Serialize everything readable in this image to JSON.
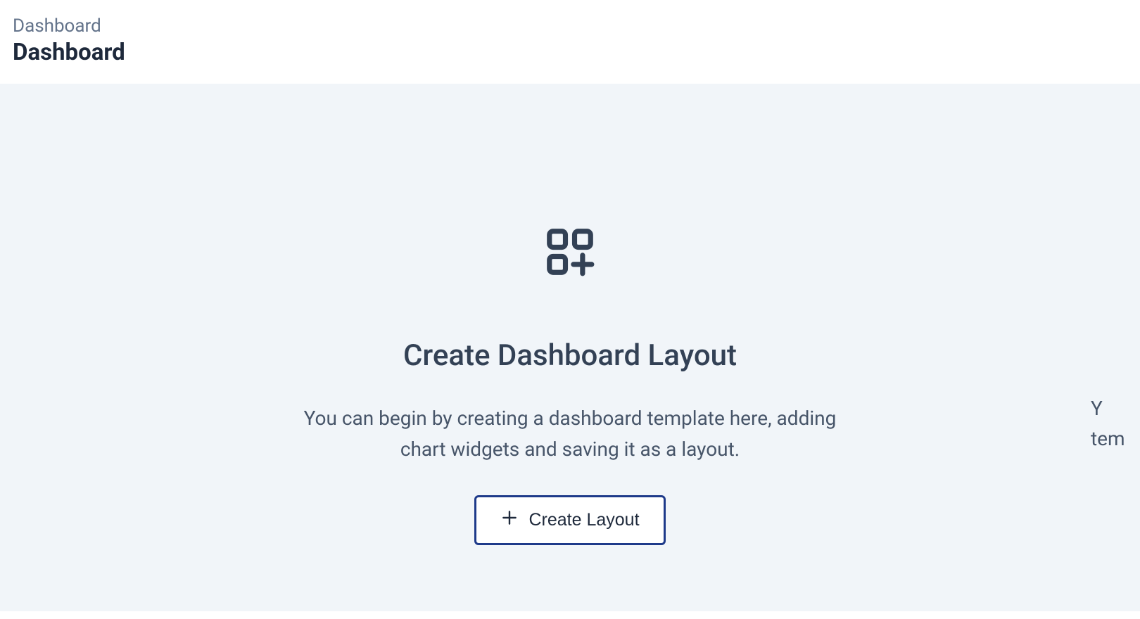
{
  "header": {
    "breadcrumb": "Dashboard",
    "title": "Dashboard"
  },
  "empty_state": {
    "heading": "Create Dashboard Layout",
    "description": "You can begin by creating a dashboard template here, adding chart widgets and saving it as a layout.",
    "button_label": "Create Layout"
  },
  "peek": {
    "partial": "Y\ntem"
  }
}
